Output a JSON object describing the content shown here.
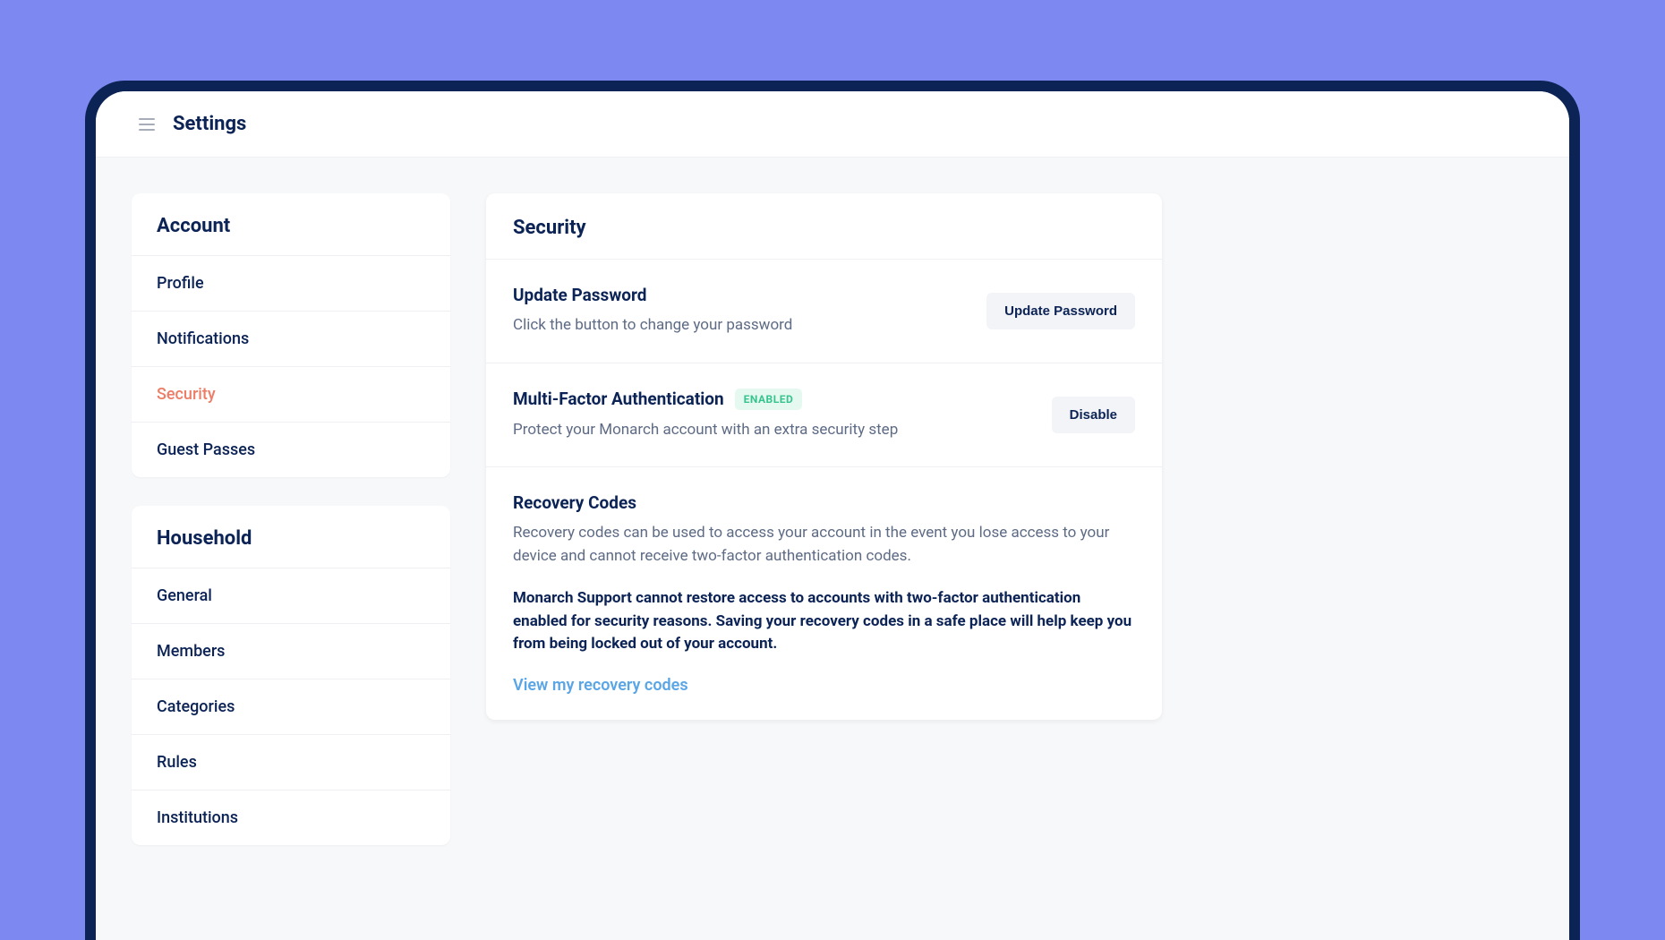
{
  "topbar": {
    "title": "Settings"
  },
  "sidebar": {
    "groups": [
      {
        "header": "Account",
        "items": [
          {
            "label": "Profile",
            "name": "sidebar-item-profile",
            "active": false
          },
          {
            "label": "Notifications",
            "name": "sidebar-item-notifications",
            "active": false
          },
          {
            "label": "Security",
            "name": "sidebar-item-security",
            "active": true
          },
          {
            "label": "Guest Passes",
            "name": "sidebar-item-guest-passes",
            "active": false
          }
        ]
      },
      {
        "header": "Household",
        "items": [
          {
            "label": "General",
            "name": "sidebar-item-general",
            "active": false
          },
          {
            "label": "Members",
            "name": "sidebar-item-members",
            "active": false
          },
          {
            "label": "Categories",
            "name": "sidebar-item-categories",
            "active": false
          },
          {
            "label": "Rules",
            "name": "sidebar-item-rules",
            "active": false
          },
          {
            "label": "Institutions",
            "name": "sidebar-item-institutions",
            "active": false
          }
        ]
      }
    ]
  },
  "main": {
    "title": "Security",
    "password": {
      "title": "Update Password",
      "subtitle": "Click the button to change your password",
      "button": "Update Password"
    },
    "mfa": {
      "title": "Multi-Factor Authentication",
      "badge": "ENABLED",
      "subtitle": "Protect your Monarch account with an extra security step",
      "button": "Disable"
    },
    "recovery": {
      "title": "Recovery Codes",
      "desc": "Recovery codes can be used to access your account in the event you lose access to your device and cannot receive two-factor authentication codes.",
      "warning": "Monarch Support cannot restore access to accounts with two-factor authentication enabled for security reasons. Saving your recovery codes in a safe place will help keep you from being locked out of your account.",
      "link": "View my recovery codes"
    }
  }
}
